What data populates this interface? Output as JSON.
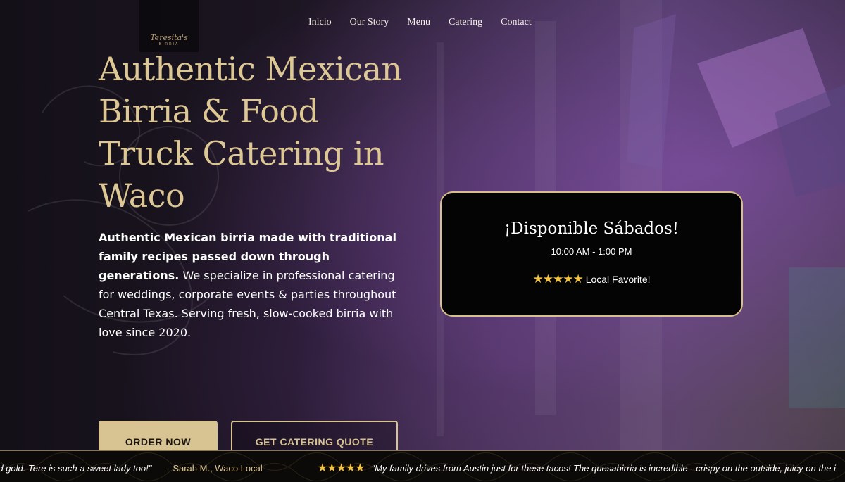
{
  "brand": {
    "logo_name": "Teresita's",
    "logo_sub": "BIRRIA"
  },
  "nav": {
    "items": [
      "Inicio",
      "Our Story",
      "Menu",
      "Catering",
      "Contact"
    ]
  },
  "hero": {
    "title": "Authentic Mexican Birria & Food Truck Catering in Waco",
    "text_bold": "Authentic Mexican birria made with traditional family recipes passed down through generations.",
    "text_body": " We specialize in professional catering for weddings, corporate events & parties throughout Central Texas. Serving fresh, slow-cooked birria with love since 2020.",
    "order_button": "ORDER NOW",
    "quote_button": "GET CATERING QUOTE"
  },
  "availability": {
    "title": "¡Disponible Sábados!",
    "hours": "10:00 AM - 1:00 PM",
    "stars": "★★★★★",
    "rating_label": "Local Favorite!"
  },
  "testimonials": [
    {
      "stars": "",
      "quote": "quid gold. Tere is such a sweet lady too!\"",
      "author": "- Sarah M., Waco Local"
    },
    {
      "stars": "★★★★★",
      "quote": "\"My family drives from Austin just for these tacos! The quesabirria is incredible - crispy on the outside, juicy on the i",
      "author": ""
    }
  ],
  "colors": {
    "accent_gold": "#d8c392",
    "star_gold": "#f4c542",
    "card_bg": "#050405"
  }
}
